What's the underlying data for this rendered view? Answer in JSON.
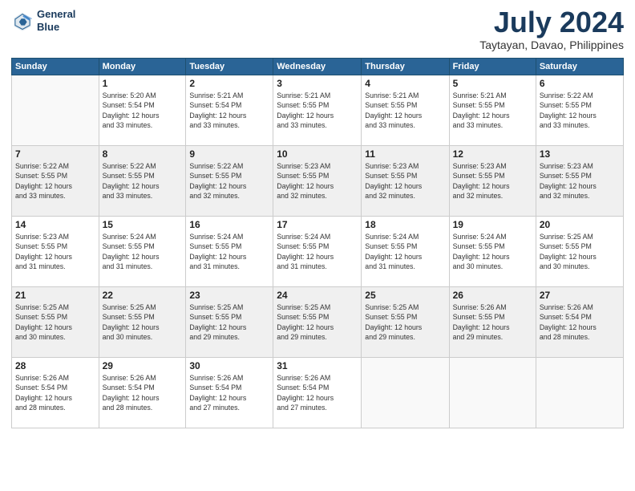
{
  "logo": {
    "line1": "General",
    "line2": "Blue"
  },
  "title": {
    "month_year": "July 2024",
    "location": "Taytayan, Davao, Philippines"
  },
  "headers": [
    "Sunday",
    "Monday",
    "Tuesday",
    "Wednesday",
    "Thursday",
    "Friday",
    "Saturday"
  ],
  "weeks": [
    [
      {
        "day": "",
        "info": ""
      },
      {
        "day": "1",
        "info": "Sunrise: 5:20 AM\nSunset: 5:54 PM\nDaylight: 12 hours\nand 33 minutes."
      },
      {
        "day": "2",
        "info": "Sunrise: 5:21 AM\nSunset: 5:54 PM\nDaylight: 12 hours\nand 33 minutes."
      },
      {
        "day": "3",
        "info": "Sunrise: 5:21 AM\nSunset: 5:55 PM\nDaylight: 12 hours\nand 33 minutes."
      },
      {
        "day": "4",
        "info": "Sunrise: 5:21 AM\nSunset: 5:55 PM\nDaylight: 12 hours\nand 33 minutes."
      },
      {
        "day": "5",
        "info": "Sunrise: 5:21 AM\nSunset: 5:55 PM\nDaylight: 12 hours\nand 33 minutes."
      },
      {
        "day": "6",
        "info": "Sunrise: 5:22 AM\nSunset: 5:55 PM\nDaylight: 12 hours\nand 33 minutes."
      }
    ],
    [
      {
        "day": "7",
        "info": "Sunrise: 5:22 AM\nSunset: 5:55 PM\nDaylight: 12 hours\nand 33 minutes."
      },
      {
        "day": "8",
        "info": "Sunrise: 5:22 AM\nSunset: 5:55 PM\nDaylight: 12 hours\nand 33 minutes."
      },
      {
        "day": "9",
        "info": "Sunrise: 5:22 AM\nSunset: 5:55 PM\nDaylight: 12 hours\nand 32 minutes."
      },
      {
        "day": "10",
        "info": "Sunrise: 5:23 AM\nSunset: 5:55 PM\nDaylight: 12 hours\nand 32 minutes."
      },
      {
        "day": "11",
        "info": "Sunrise: 5:23 AM\nSunset: 5:55 PM\nDaylight: 12 hours\nand 32 minutes."
      },
      {
        "day": "12",
        "info": "Sunrise: 5:23 AM\nSunset: 5:55 PM\nDaylight: 12 hours\nand 32 minutes."
      },
      {
        "day": "13",
        "info": "Sunrise: 5:23 AM\nSunset: 5:55 PM\nDaylight: 12 hours\nand 32 minutes."
      }
    ],
    [
      {
        "day": "14",
        "info": "Sunrise: 5:23 AM\nSunset: 5:55 PM\nDaylight: 12 hours\nand 31 minutes."
      },
      {
        "day": "15",
        "info": "Sunrise: 5:24 AM\nSunset: 5:55 PM\nDaylight: 12 hours\nand 31 minutes."
      },
      {
        "day": "16",
        "info": "Sunrise: 5:24 AM\nSunset: 5:55 PM\nDaylight: 12 hours\nand 31 minutes."
      },
      {
        "day": "17",
        "info": "Sunrise: 5:24 AM\nSunset: 5:55 PM\nDaylight: 12 hours\nand 31 minutes."
      },
      {
        "day": "18",
        "info": "Sunrise: 5:24 AM\nSunset: 5:55 PM\nDaylight: 12 hours\nand 31 minutes."
      },
      {
        "day": "19",
        "info": "Sunrise: 5:24 AM\nSunset: 5:55 PM\nDaylight: 12 hours\nand 30 minutes."
      },
      {
        "day": "20",
        "info": "Sunrise: 5:25 AM\nSunset: 5:55 PM\nDaylight: 12 hours\nand 30 minutes."
      }
    ],
    [
      {
        "day": "21",
        "info": "Sunrise: 5:25 AM\nSunset: 5:55 PM\nDaylight: 12 hours\nand 30 minutes."
      },
      {
        "day": "22",
        "info": "Sunrise: 5:25 AM\nSunset: 5:55 PM\nDaylight: 12 hours\nand 30 minutes."
      },
      {
        "day": "23",
        "info": "Sunrise: 5:25 AM\nSunset: 5:55 PM\nDaylight: 12 hours\nand 29 minutes."
      },
      {
        "day": "24",
        "info": "Sunrise: 5:25 AM\nSunset: 5:55 PM\nDaylight: 12 hours\nand 29 minutes."
      },
      {
        "day": "25",
        "info": "Sunrise: 5:25 AM\nSunset: 5:55 PM\nDaylight: 12 hours\nand 29 minutes."
      },
      {
        "day": "26",
        "info": "Sunrise: 5:26 AM\nSunset: 5:55 PM\nDaylight: 12 hours\nand 29 minutes."
      },
      {
        "day": "27",
        "info": "Sunrise: 5:26 AM\nSunset: 5:54 PM\nDaylight: 12 hours\nand 28 minutes."
      }
    ],
    [
      {
        "day": "28",
        "info": "Sunrise: 5:26 AM\nSunset: 5:54 PM\nDaylight: 12 hours\nand 28 minutes."
      },
      {
        "day": "29",
        "info": "Sunrise: 5:26 AM\nSunset: 5:54 PM\nDaylight: 12 hours\nand 28 minutes."
      },
      {
        "day": "30",
        "info": "Sunrise: 5:26 AM\nSunset: 5:54 PM\nDaylight: 12 hours\nand 27 minutes."
      },
      {
        "day": "31",
        "info": "Sunrise: 5:26 AM\nSunset: 5:54 PM\nDaylight: 12 hours\nand 27 minutes."
      },
      {
        "day": "",
        "info": ""
      },
      {
        "day": "",
        "info": ""
      },
      {
        "day": "",
        "info": ""
      }
    ]
  ]
}
